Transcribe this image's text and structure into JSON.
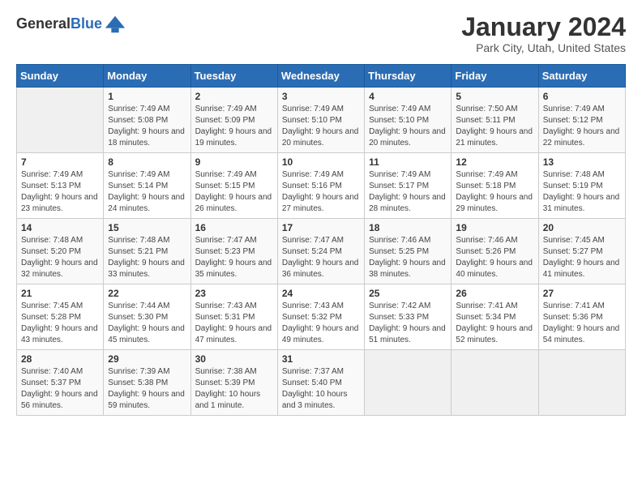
{
  "header": {
    "logo_general": "General",
    "logo_blue": "Blue",
    "month_title": "January 2024",
    "location": "Park City, Utah, United States"
  },
  "days_of_week": [
    "Sunday",
    "Monday",
    "Tuesday",
    "Wednesday",
    "Thursday",
    "Friday",
    "Saturday"
  ],
  "weeks": [
    [
      {
        "day": "",
        "empty": true
      },
      {
        "day": "1",
        "sunrise": "Sunrise: 7:49 AM",
        "sunset": "Sunset: 5:08 PM",
        "daylight": "Daylight: 9 hours and 18 minutes."
      },
      {
        "day": "2",
        "sunrise": "Sunrise: 7:49 AM",
        "sunset": "Sunset: 5:09 PM",
        "daylight": "Daylight: 9 hours and 19 minutes."
      },
      {
        "day": "3",
        "sunrise": "Sunrise: 7:49 AM",
        "sunset": "Sunset: 5:10 PM",
        "daylight": "Daylight: 9 hours and 20 minutes."
      },
      {
        "day": "4",
        "sunrise": "Sunrise: 7:49 AM",
        "sunset": "Sunset: 5:10 PM",
        "daylight": "Daylight: 9 hours and 20 minutes."
      },
      {
        "day": "5",
        "sunrise": "Sunrise: 7:50 AM",
        "sunset": "Sunset: 5:11 PM",
        "daylight": "Daylight: 9 hours and 21 minutes."
      },
      {
        "day": "6",
        "sunrise": "Sunrise: 7:49 AM",
        "sunset": "Sunset: 5:12 PM",
        "daylight": "Daylight: 9 hours and 22 minutes."
      }
    ],
    [
      {
        "day": "7",
        "sunrise": "Sunrise: 7:49 AM",
        "sunset": "Sunset: 5:13 PM",
        "daylight": "Daylight: 9 hours and 23 minutes."
      },
      {
        "day": "8",
        "sunrise": "Sunrise: 7:49 AM",
        "sunset": "Sunset: 5:14 PM",
        "daylight": "Daylight: 9 hours and 24 minutes."
      },
      {
        "day": "9",
        "sunrise": "Sunrise: 7:49 AM",
        "sunset": "Sunset: 5:15 PM",
        "daylight": "Daylight: 9 hours and 26 minutes."
      },
      {
        "day": "10",
        "sunrise": "Sunrise: 7:49 AM",
        "sunset": "Sunset: 5:16 PM",
        "daylight": "Daylight: 9 hours and 27 minutes."
      },
      {
        "day": "11",
        "sunrise": "Sunrise: 7:49 AM",
        "sunset": "Sunset: 5:17 PM",
        "daylight": "Daylight: 9 hours and 28 minutes."
      },
      {
        "day": "12",
        "sunrise": "Sunrise: 7:49 AM",
        "sunset": "Sunset: 5:18 PM",
        "daylight": "Daylight: 9 hours and 29 minutes."
      },
      {
        "day": "13",
        "sunrise": "Sunrise: 7:48 AM",
        "sunset": "Sunset: 5:19 PM",
        "daylight": "Daylight: 9 hours and 31 minutes."
      }
    ],
    [
      {
        "day": "14",
        "sunrise": "Sunrise: 7:48 AM",
        "sunset": "Sunset: 5:20 PM",
        "daylight": "Daylight: 9 hours and 32 minutes."
      },
      {
        "day": "15",
        "sunrise": "Sunrise: 7:48 AM",
        "sunset": "Sunset: 5:21 PM",
        "daylight": "Daylight: 9 hours and 33 minutes."
      },
      {
        "day": "16",
        "sunrise": "Sunrise: 7:47 AM",
        "sunset": "Sunset: 5:23 PM",
        "daylight": "Daylight: 9 hours and 35 minutes."
      },
      {
        "day": "17",
        "sunrise": "Sunrise: 7:47 AM",
        "sunset": "Sunset: 5:24 PM",
        "daylight": "Daylight: 9 hours and 36 minutes."
      },
      {
        "day": "18",
        "sunrise": "Sunrise: 7:46 AM",
        "sunset": "Sunset: 5:25 PM",
        "daylight": "Daylight: 9 hours and 38 minutes."
      },
      {
        "day": "19",
        "sunrise": "Sunrise: 7:46 AM",
        "sunset": "Sunset: 5:26 PM",
        "daylight": "Daylight: 9 hours and 40 minutes."
      },
      {
        "day": "20",
        "sunrise": "Sunrise: 7:45 AM",
        "sunset": "Sunset: 5:27 PM",
        "daylight": "Daylight: 9 hours and 41 minutes."
      }
    ],
    [
      {
        "day": "21",
        "sunrise": "Sunrise: 7:45 AM",
        "sunset": "Sunset: 5:28 PM",
        "daylight": "Daylight: 9 hours and 43 minutes."
      },
      {
        "day": "22",
        "sunrise": "Sunrise: 7:44 AM",
        "sunset": "Sunset: 5:30 PM",
        "daylight": "Daylight: 9 hours and 45 minutes."
      },
      {
        "day": "23",
        "sunrise": "Sunrise: 7:43 AM",
        "sunset": "Sunset: 5:31 PM",
        "daylight": "Daylight: 9 hours and 47 minutes."
      },
      {
        "day": "24",
        "sunrise": "Sunrise: 7:43 AM",
        "sunset": "Sunset: 5:32 PM",
        "daylight": "Daylight: 9 hours and 49 minutes."
      },
      {
        "day": "25",
        "sunrise": "Sunrise: 7:42 AM",
        "sunset": "Sunset: 5:33 PM",
        "daylight": "Daylight: 9 hours and 51 minutes."
      },
      {
        "day": "26",
        "sunrise": "Sunrise: 7:41 AM",
        "sunset": "Sunset: 5:34 PM",
        "daylight": "Daylight: 9 hours and 52 minutes."
      },
      {
        "day": "27",
        "sunrise": "Sunrise: 7:41 AM",
        "sunset": "Sunset: 5:36 PM",
        "daylight": "Daylight: 9 hours and 54 minutes."
      }
    ],
    [
      {
        "day": "28",
        "sunrise": "Sunrise: 7:40 AM",
        "sunset": "Sunset: 5:37 PM",
        "daylight": "Daylight: 9 hours and 56 minutes."
      },
      {
        "day": "29",
        "sunrise": "Sunrise: 7:39 AM",
        "sunset": "Sunset: 5:38 PM",
        "daylight": "Daylight: 9 hours and 59 minutes."
      },
      {
        "day": "30",
        "sunrise": "Sunrise: 7:38 AM",
        "sunset": "Sunset: 5:39 PM",
        "daylight": "Daylight: 10 hours and 1 minute."
      },
      {
        "day": "31",
        "sunrise": "Sunrise: 7:37 AM",
        "sunset": "Sunset: 5:40 PM",
        "daylight": "Daylight: 10 hours and 3 minutes."
      },
      {
        "day": "",
        "empty": true
      },
      {
        "day": "",
        "empty": true
      },
      {
        "day": "",
        "empty": true
      }
    ]
  ]
}
